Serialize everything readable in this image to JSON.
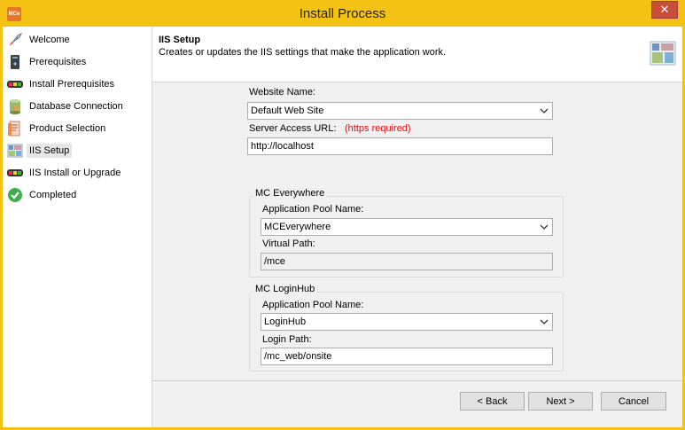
{
  "window": {
    "title": "Install Process",
    "close_label": "✕",
    "app_icon_text": "MCe"
  },
  "sidebar": {
    "items": [
      {
        "label": "Welcome",
        "icon": "rocket-icon"
      },
      {
        "label": "Prerequisites",
        "icon": "server-icon"
      },
      {
        "label": "Install Prerequisites",
        "icon": "progress-icon"
      },
      {
        "label": "Database Connection",
        "icon": "database-icon"
      },
      {
        "label": "Product Selection",
        "icon": "product-icon"
      },
      {
        "label": "IIS Setup",
        "icon": "iis-icon",
        "active": true
      },
      {
        "label": "IIS Install or Upgrade",
        "icon": "progress-icon"
      },
      {
        "label": "Completed",
        "icon": "checkmark-icon"
      }
    ]
  },
  "header": {
    "title": "IIS Setup",
    "subtitle": "Creates or updates the IIS settings that make the application work."
  },
  "form": {
    "website_name_label": "Website Name:",
    "website_name_value": "Default Web Site",
    "server_url_label": "Server Access URL:",
    "server_url_note": "(https required)",
    "server_url_value": "http://localhost",
    "mce": {
      "group_title": "MC Everywhere",
      "pool_label": "Application Pool Name:",
      "pool_value": "MCEverywhere",
      "path_label": "Virtual Path:",
      "path_value": "/mce"
    },
    "loginhub": {
      "group_title": "MC LoginHub",
      "pool_label": "Application Pool Name:",
      "pool_value": "LoginHub",
      "path_label": "Login Path:",
      "path_value": "/mc_web/onsite"
    }
  },
  "buttons": {
    "back": "< Back",
    "next": "Next >",
    "cancel": "Cancel"
  }
}
